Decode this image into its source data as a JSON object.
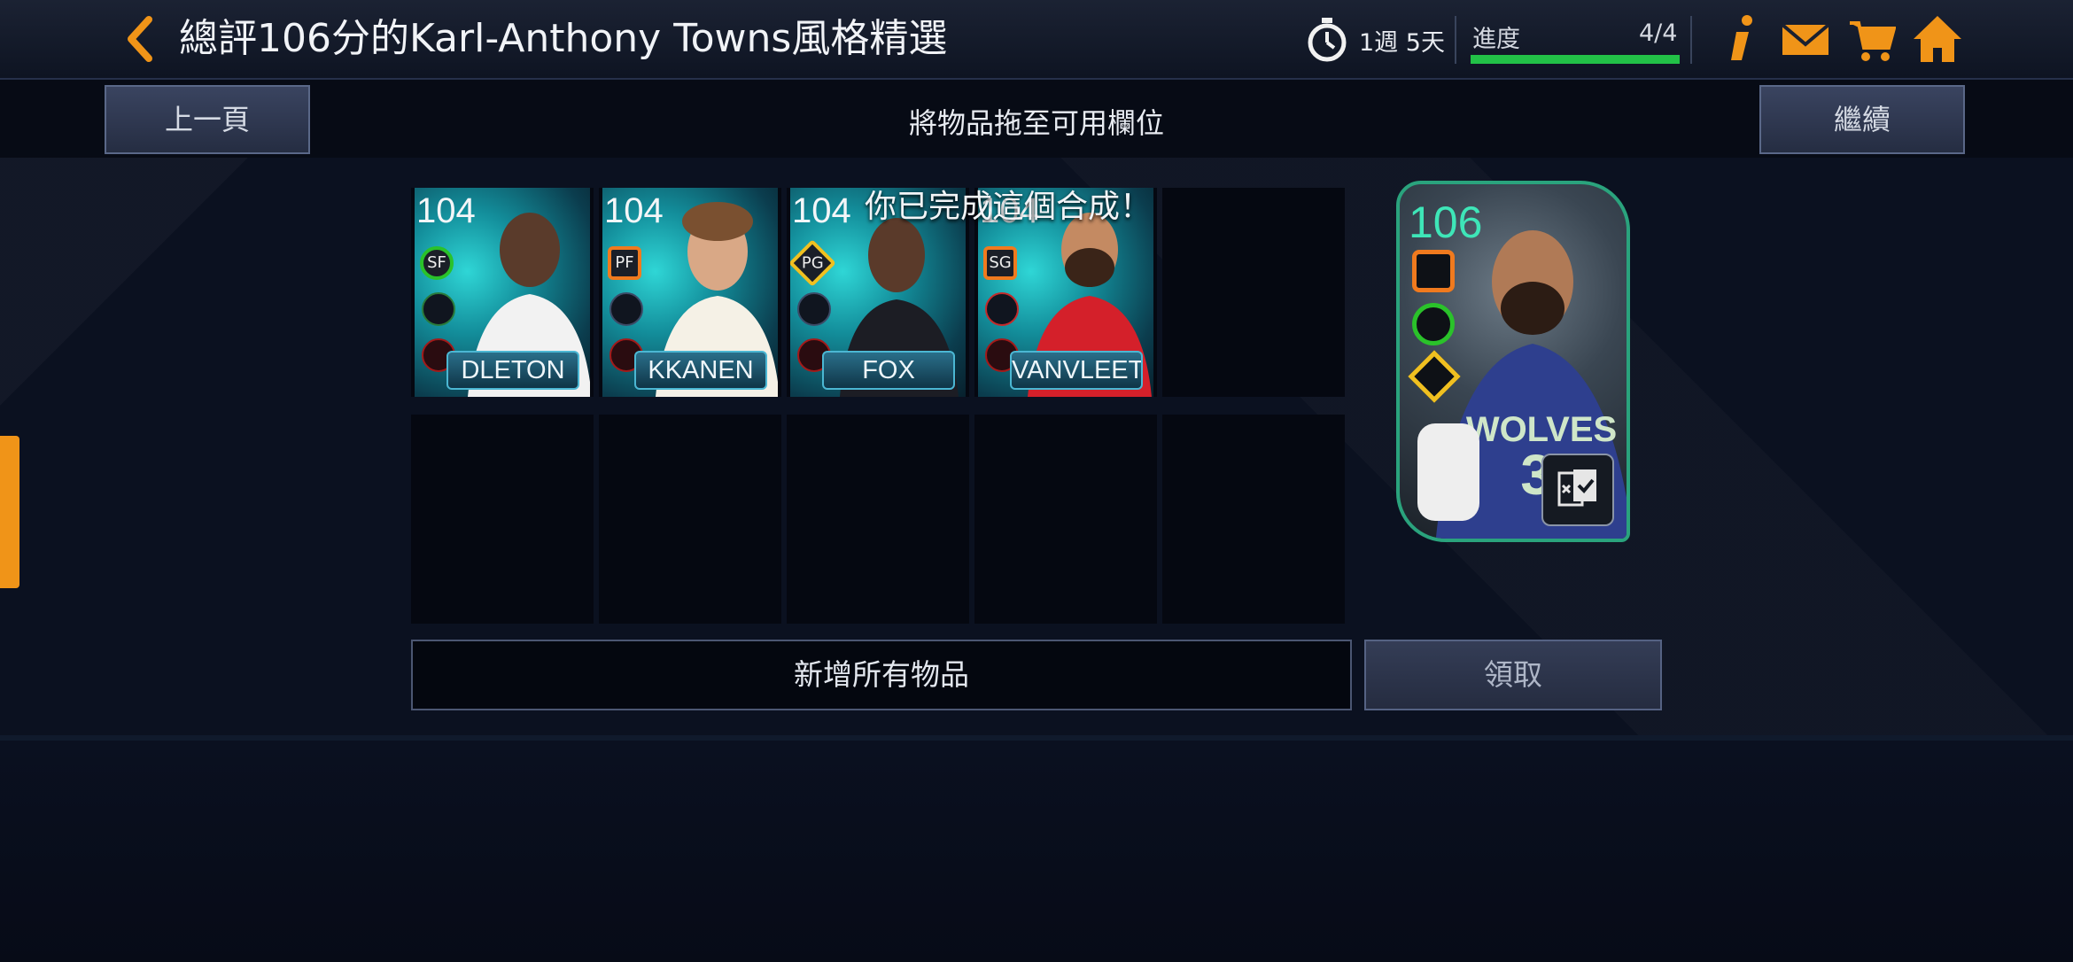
{
  "header": {
    "title": "總評106分的Karl-Anthony Towns風格精選",
    "timer": "1週 5天",
    "progress_label": "進度",
    "progress_value": "4/4",
    "progress_fraction": 1.0,
    "icons": [
      "back-arrow-icon",
      "stopwatch-icon",
      "info-icon",
      "mail-icon",
      "cart-icon",
      "home-icon"
    ]
  },
  "subbar": {
    "prev_label": "上一頁",
    "instruction": "將物品拖至可用欄位",
    "continue_label": "繼續"
  },
  "completed_message": "你已完成這個合成！",
  "cards": [
    {
      "rating": "104",
      "position": "SF",
      "name": "DLETON",
      "position_shape": "circle",
      "position_color": "#2ac22a"
    },
    {
      "rating": "104",
      "position": "PF",
      "name": "KKANEN",
      "position_shape": "square",
      "position_color": "#f07a1e"
    },
    {
      "rating": "104",
      "position": "PG",
      "name": "FOX",
      "position_shape": "diamond",
      "position_color": "#f0c020"
    },
    {
      "rating": "104",
      "position": "SG",
      "name": "VANVLEET",
      "position_shape": "square",
      "position_color": "#f07a1e"
    }
  ],
  "reward": {
    "rating": "106",
    "jersey_text": "WOLVES",
    "jersey_number": "32"
  },
  "actions": {
    "add_all_label": "新增所有物品",
    "claim_label": "領取"
  },
  "colors": {
    "accent_orange": "#f09418",
    "progress_green": "#22c147",
    "reward_rating": "#3ee6b8"
  }
}
